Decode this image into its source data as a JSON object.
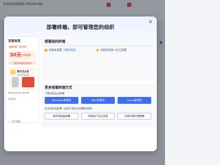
{
  "background": {
    "header_items": [
      "专业安全进程服务 (Windows版)"
    ],
    "list_items": [
      "Wed-1",
      "Wed-2",
      "Wed-3"
    ]
  },
  "modal": {
    "title": "部署终端，即可管理您的组织",
    "close_label": "×"
  },
  "promo": {
    "heading": "安装有奖",
    "tag_left": "活动时间",
    "tag_right": "活动规则",
    "big_number": "30天",
    "big_text": "专业版权益",
    "subtitle": "安装前需领取免费试用",
    "card_title": "积分兑大奖",
    "card_sub": "活动期间赢奖励",
    "product_left": "iPhone14 Pro",
    "product_right": "JD E卡",
    "more": "查看更多"
  },
  "section_my_terminals": {
    "title": "部署我的终端",
    "status_left_prefix": "终端未部署",
    "status_left_link": "下载安装包",
    "status_right": "同组织终端 0台已部署",
    "colors": {
      "dot_left": "#ff9a2e",
      "dot_right": "#ffb74d"
    }
  },
  "section_more": {
    "title": "更多部署终端方式",
    "sub1": "下载安装包并部署",
    "buttons_primary": [
      "Windows安装包",
      "Mac安装包",
      "Linux安装包"
    ],
    "sub2": "自动或批量部署（适用于组织内部署终端等）",
    "buttons_secondary": [
      "域环境批量部署",
      "终端用户自主安装",
      "内网环境代理部署"
    ]
  },
  "footer": {
    "text": "✓ 不再提醒"
  },
  "colors": {
    "accent": "#3f6df6",
    "promo_red": "#e8371f"
  }
}
